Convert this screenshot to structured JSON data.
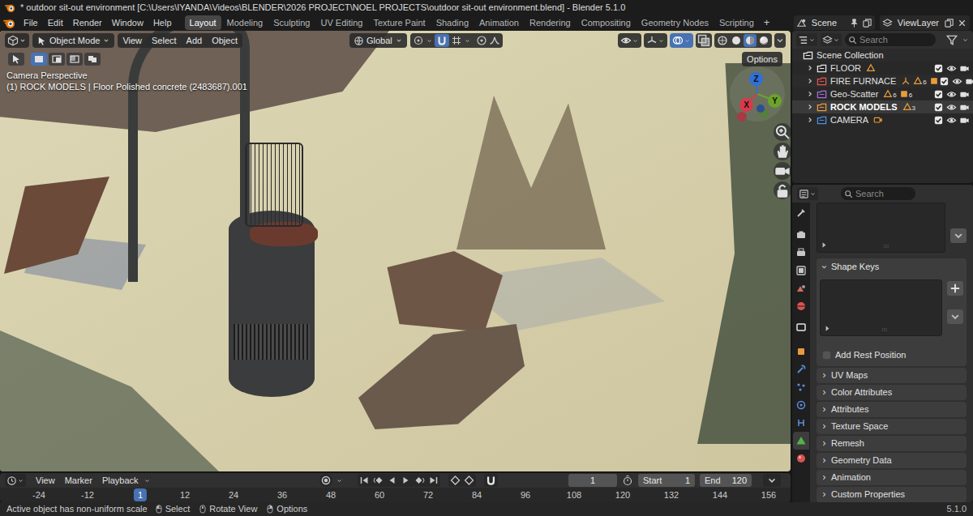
{
  "window": {
    "title": "* outdoor sit-out environment [C:\\Users\\IYANDA\\Videos\\BLENDER\\2026 PROJECT\\NOEL PROJECTS\\outdoor sit-out environment.blend] - Blender 5.1.0"
  },
  "menu": [
    "File",
    "Edit",
    "Render",
    "Window",
    "Help"
  ],
  "workspaces": [
    {
      "label": "Layout",
      "selected": true
    },
    {
      "label": "Modeling",
      "selected": false
    },
    {
      "label": "Sculpting",
      "selected": false
    },
    {
      "label": "UV Editing",
      "selected": false
    },
    {
      "label": "Texture Paint",
      "selected": false
    },
    {
      "label": "Shading",
      "selected": false
    },
    {
      "label": "Animation",
      "selected": false
    },
    {
      "label": "Rendering",
      "selected": false
    },
    {
      "label": "Compositing",
      "selected": false
    },
    {
      "label": "Geometry Nodes",
      "selected": false
    },
    {
      "label": "Scripting",
      "selected": false
    }
  ],
  "add_workspace": "+",
  "scene": "Scene",
  "view_layer": "ViewLayer",
  "viewport": {
    "mode": "Object Mode",
    "menus": [
      "View",
      "Select",
      "Add",
      "Object"
    ],
    "orientation": "Global",
    "options": "Options",
    "select_modes": [
      {
        "selected": false
      },
      {
        "selected": true
      },
      {
        "selected": false
      },
      {
        "selected": false
      },
      {
        "selected": false
      }
    ],
    "shading": [
      {
        "selected": false
      },
      {
        "selected": false
      },
      {
        "selected": true
      },
      {
        "selected": false
      }
    ],
    "overlay": [
      "Camera Perspective",
      "(1) ROCK MODELS | Floor Polished concrete (2483687).001"
    ],
    "axes": [
      {
        "label": "Z",
        "color": "#2f6fd6"
      },
      {
        "label": "Y",
        "color": "#6ba32a"
      },
      {
        "label": "X",
        "color": "#d9394a"
      }
    ]
  },
  "outliner": {
    "search": {
      "placeholder": "Search"
    },
    "root": {
      "name": "Scene Collection"
    },
    "items": [
      {
        "name": "FLOOR",
        "color": "#e6e6e6",
        "active": false,
        "included": true,
        "visible": true,
        "renderable": true,
        "contents": [
          {
            "kind": "mesh"
          }
        ]
      },
      {
        "name": "FIRE FURNACE",
        "color": "#e5534b",
        "active": false,
        "included": true,
        "visible": true,
        "renderable": true,
        "contents": [
          {
            "kind": "empty"
          },
          {
            "kind": "mesh",
            "count": "6"
          },
          {
            "kind": "object"
          }
        ]
      },
      {
        "name": "Geo-Scatter",
        "color": "#a26fd6",
        "active": false,
        "included": true,
        "visible": true,
        "renderable": true,
        "contents": [
          {
            "kind": "mesh",
            "count": "6"
          },
          {
            "kind": "object",
            "count": "6"
          }
        ]
      },
      {
        "name": "ROCK MODELS",
        "color": "#e89a3c",
        "active": true,
        "included": true,
        "visible": true,
        "renderable": true,
        "contents": [
          {
            "kind": "mesh",
            "count": "3"
          }
        ]
      },
      {
        "name": "CAMERA",
        "color": "#4b8fe0",
        "active": false,
        "included": true,
        "visible": true,
        "renderable": true,
        "contents": [
          {
            "kind": "camera"
          }
        ]
      }
    ]
  },
  "properties": {
    "search": {
      "placeholder": "Search"
    },
    "tabs": [
      {
        "selected": false,
        "color": "#c8c8c8"
      },
      {
        "selected": false,
        "color": "#c8c8c8"
      },
      {
        "selected": false,
        "color": "#c8c8c8"
      },
      {
        "selected": false,
        "color": "#c8c8c8"
      },
      {
        "selected": false,
        "color": "#d06a5a"
      },
      {
        "selected": false,
        "color": "#d9534f"
      },
      {
        "selected": false,
        "color": "#e6e6e6"
      },
      {
        "selected": false,
        "color": "#e89a3c"
      },
      {
        "selected": false,
        "color": "#5a8fd8"
      },
      {
        "selected": false,
        "color": "#5a8fd8"
      },
      {
        "selected": false,
        "color": "#5a8fd8"
      },
      {
        "selected": false,
        "color": "#5a8fd8"
      },
      {
        "selected": true,
        "color": "#55b24a"
      },
      {
        "selected": false,
        "color": "#d9534f"
      }
    ],
    "shape_keys": {
      "label": "Shape Keys",
      "expanded": true
    },
    "add_rest_position": {
      "label": "Add Rest Position",
      "checked": false
    },
    "panels": [
      {
        "label": "UV Maps",
        "expanded": false
      },
      {
        "label": "Color Attributes",
        "expanded": false
      },
      {
        "label": "Attributes",
        "expanded": false
      },
      {
        "label": "Texture Space",
        "expanded": false
      },
      {
        "label": "Remesh",
        "expanded": false
      },
      {
        "label": "Geometry Data",
        "expanded": false
      },
      {
        "label": "Animation",
        "expanded": false
      },
      {
        "label": "Custom Properties",
        "expanded": false
      }
    ]
  },
  "timeline": {
    "menus": [
      "View",
      "Marker",
      "Playback"
    ],
    "frame": "1",
    "start": {
      "label": "Start",
      "value": "1"
    },
    "end": {
      "label": "End",
      "value": "120"
    },
    "ruler": [
      {
        "label": "-24",
        "selected": false
      },
      {
        "label": "-12",
        "selected": false
      },
      {
        "label": "1",
        "selected": true
      },
      {
        "label": "12",
        "selected": false
      },
      {
        "label": "24",
        "selected": false
      },
      {
        "label": "36",
        "selected": false
      },
      {
        "label": "48",
        "selected": false
      },
      {
        "label": "60",
        "selected": false
      },
      {
        "label": "72",
        "selected": false
      },
      {
        "label": "84",
        "selected": false
      },
      {
        "label": "96",
        "selected": false
      },
      {
        "label": "108",
        "selected": false
      },
      {
        "label": "120",
        "selected": false
      },
      {
        "label": "132",
        "selected": false
      },
      {
        "label": "144",
        "selected": false
      },
      {
        "label": "156",
        "selected": false
      }
    ]
  },
  "status_bar": {
    "message": "Active object has non-uniform scale",
    "hints": [
      "Select",
      "Rotate View",
      "Options"
    ],
    "version": "5.1.0"
  }
}
